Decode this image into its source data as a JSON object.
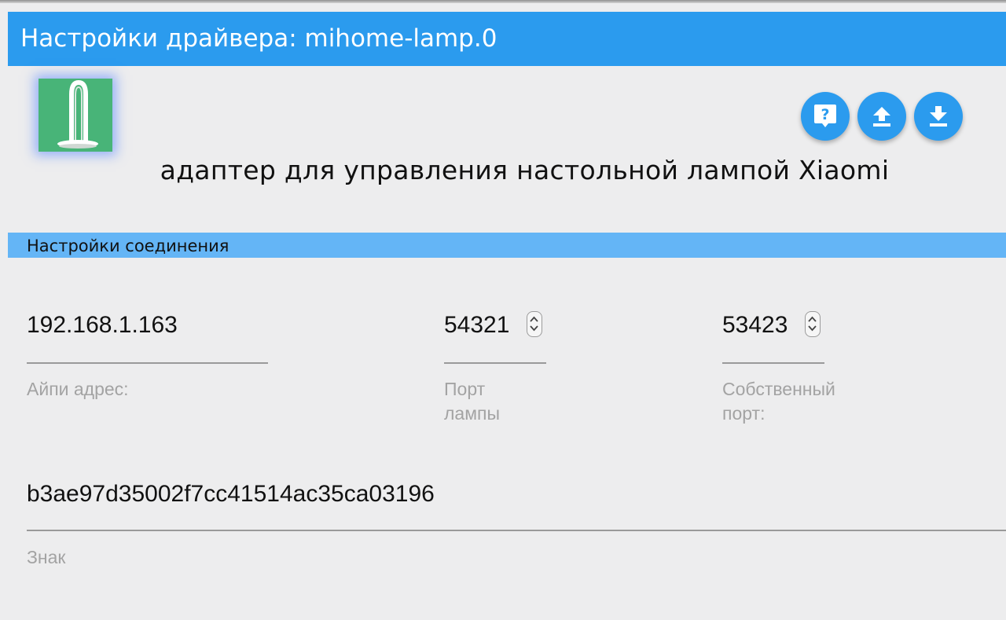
{
  "window": {
    "title": "Настройки драйвера: mihome-lamp.0"
  },
  "header": {
    "logo_icon": "desk-lamp-logo",
    "buttons": [
      {
        "icon": "help-icon",
        "label": "help"
      },
      {
        "icon": "upload-icon",
        "label": "load config"
      },
      {
        "icon": "download-icon",
        "label": "save config"
      }
    ],
    "description": "адаптер для управления настольной лампой Xiaomi"
  },
  "section": {
    "title": "Настройки соединения"
  },
  "fields": {
    "ip": {
      "value": "192.168.1.163",
      "label": "Айпи адрес:"
    },
    "lamp_port": {
      "value": "54321",
      "label_line1": "Порт",
      "label_line2": "лампы"
    },
    "own_port": {
      "value": "53423",
      "label_line1": "Собственный",
      "label_line2": "порт:"
    },
    "token": {
      "value": "b3ae97d35002f7cc41514ac35ca03196",
      "label": "Знак"
    }
  },
  "colors": {
    "accent": "#2b9bee",
    "section_header": "#64b5f6",
    "logo_background": "#48b478",
    "label_gray": "#a3a3a3"
  }
}
